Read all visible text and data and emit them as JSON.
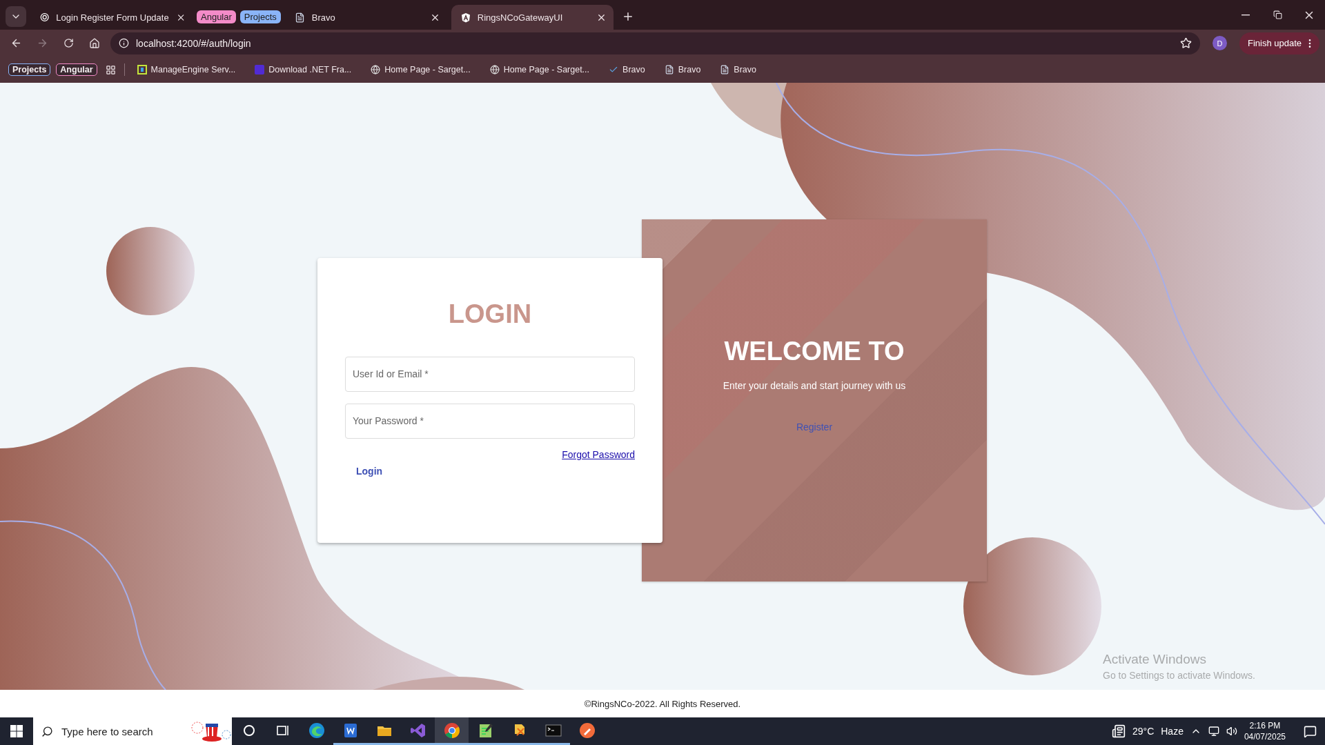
{
  "browser": {
    "tabs": [
      {
        "kind": "tab",
        "title": "Login Register Form Update",
        "selected": false
      },
      {
        "kind": "group",
        "label": "Angular",
        "color": "#f38bc8"
      },
      {
        "kind": "group",
        "label": "Projects",
        "color": "#8ab4f8"
      },
      {
        "kind": "tab",
        "title": "Bravo",
        "selected": false
      },
      {
        "kind": "tab",
        "title": "RingsNCoGatewayUI",
        "selected": true
      }
    ],
    "address": "localhost:4200/#/auth/login",
    "profile": "D",
    "update_button": "Finish update",
    "bookmarks": [
      {
        "kind": "group",
        "label": "Projects",
        "color": "#8ab4f8"
      },
      {
        "kind": "group",
        "label": "Angular",
        "color": "#f38bc8"
      },
      {
        "kind": "apps"
      },
      {
        "kind": "link",
        "label": "ManageEngine Serv..."
      },
      {
        "kind": "link",
        "label": "Download .NET Fra..."
      },
      {
        "kind": "link",
        "label": "Home Page - Sarget..."
      },
      {
        "kind": "link",
        "label": "Home Page - Sarget..."
      },
      {
        "kind": "link",
        "label": "Bravo"
      },
      {
        "kind": "link",
        "label": "Bravo"
      },
      {
        "kind": "link",
        "label": "Bravo"
      }
    ]
  },
  "login": {
    "title": "LOGIN",
    "fields": [
      {
        "placeholder": "User Id or Email *"
      },
      {
        "placeholder": "Your Password *"
      }
    ],
    "forgot_link": "Forgot Password",
    "button": "Login"
  },
  "welcome": {
    "title": "WELCOME TO",
    "subtitle": "Enter your details and start journey with us",
    "register": "Register"
  },
  "footer": "©RingsNCo-2022. All Rights Reserved.",
  "activation": {
    "title": "Activate Windows",
    "subtitle": "Go to Settings to activate Windows."
  },
  "taskbar": {
    "search_placeholder": "Type here to search",
    "apps": [
      {
        "kind": "cortana",
        "running": false,
        "selected": false
      },
      {
        "kind": "taskview",
        "running": false,
        "selected": false
      },
      {
        "kind": "edge",
        "running": false,
        "selected": false
      },
      {
        "kind": "word",
        "running": true,
        "selected": false
      },
      {
        "kind": "folder",
        "running": true,
        "selected": false
      },
      {
        "kind": "vs",
        "running": true,
        "selected": false
      },
      {
        "kind": "chrome",
        "running": true,
        "selected": true
      },
      {
        "kind": "notepad",
        "running": true,
        "selected": false
      },
      {
        "kind": "tools",
        "running": true,
        "selected": false
      },
      {
        "kind": "terminal",
        "running": true,
        "selected": false
      },
      {
        "kind": "postman",
        "running": false,
        "selected": false
      }
    ],
    "temperature": "29°C",
    "weather": "Haze",
    "time": "2:16 PM",
    "date": "04/07/2025"
  }
}
